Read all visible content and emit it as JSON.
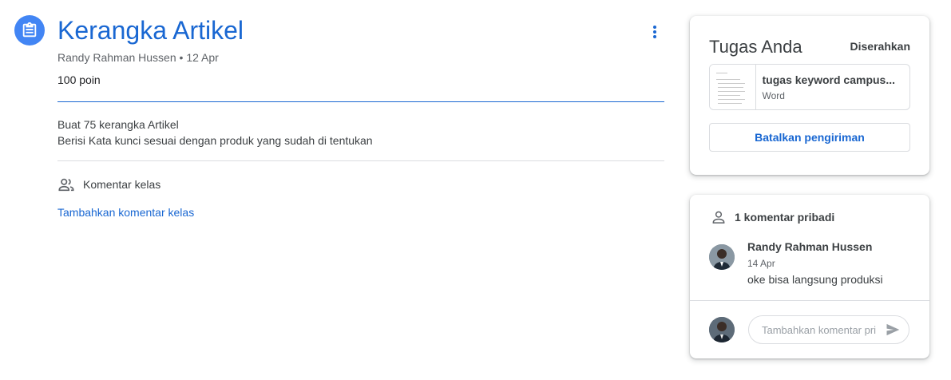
{
  "assignment": {
    "title": "Kerangka Artikel",
    "author": "Randy Rahman Hussen",
    "separator": " • ",
    "date": "12 Apr",
    "points": "100 poin",
    "description_lines": [
      "Buat 75 kerangka Artikel",
      "Berisi Kata kunci sesuai dengan produk yang sudah di tentukan"
    ],
    "icon": "assignment-icon",
    "accent_color": "#1967d2"
  },
  "class_comments": {
    "label": "Komentar kelas",
    "add_label": "Tambahkan komentar kelas",
    "icon": "people-icon"
  },
  "your_work": {
    "title": "Tugas Anda",
    "status": "Diserahkan",
    "attachment": {
      "name": "tugas keyword campus...",
      "type": "Word"
    },
    "unsubmit_label": "Batalkan pengiriman"
  },
  "private_comments": {
    "header": "1 komentar pribadi",
    "icon": "person-icon",
    "comments": [
      {
        "author": "Randy Rahman Hussen",
        "date": "14 Apr",
        "text": "oke bisa langsung produksi"
      }
    ],
    "input_placeholder": "Tambahkan komentar pri"
  }
}
